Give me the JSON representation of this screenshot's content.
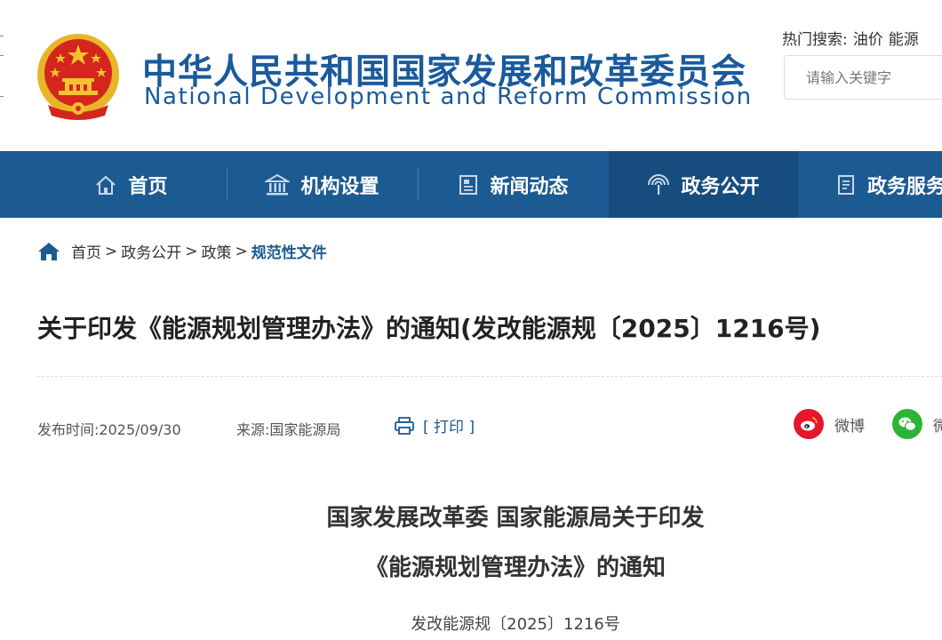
{
  "header": {
    "title_cn": "中华人民共和国国家发展和改革委员会",
    "title_en": "National Development and Reform Commission",
    "hot_search_label": "热门搜索:",
    "hot_search_terms": [
      "油价",
      "能源"
    ],
    "search_placeholder": "请输入关键字"
  },
  "nav": {
    "items": [
      {
        "label": "首页",
        "icon": "home-icon"
      },
      {
        "label": "机构设置",
        "icon": "institution-icon"
      },
      {
        "label": "新闻动态",
        "icon": "newspaper-icon"
      },
      {
        "label": "政务公开",
        "icon": "broadcast-icon",
        "active": true
      },
      {
        "label": "政务服务",
        "icon": "document-icon"
      }
    ]
  },
  "breadcrumb": {
    "items": [
      "首页",
      "政务公开",
      "政策"
    ],
    "current": "规范性文件",
    "separator": ">"
  },
  "article": {
    "title": "关于印发《能源规划管理办法》的通知(发改能源规〔2025〕1216号)",
    "publish_label": "发布时间:",
    "publish_date": "2025/09/30",
    "source_label": "来源:",
    "source": "国家能源局",
    "print_label": "[ 打印 ]",
    "share_weibo": "微博",
    "share_wechat": "微",
    "doc_heading_line1": "国家发展改革委 国家能源局关于印发",
    "doc_heading_line2": "《能源规划管理办法》的通知",
    "doc_number": "发改能源规〔2025〕1216号"
  },
  "colors": {
    "brand_blue": "#1c5a92",
    "nav_active": "#174c7e",
    "emblem_red": "#d4261c",
    "emblem_gold": "#f2c230",
    "weibo_red": "#e6162d",
    "wechat_green": "#2db336"
  }
}
